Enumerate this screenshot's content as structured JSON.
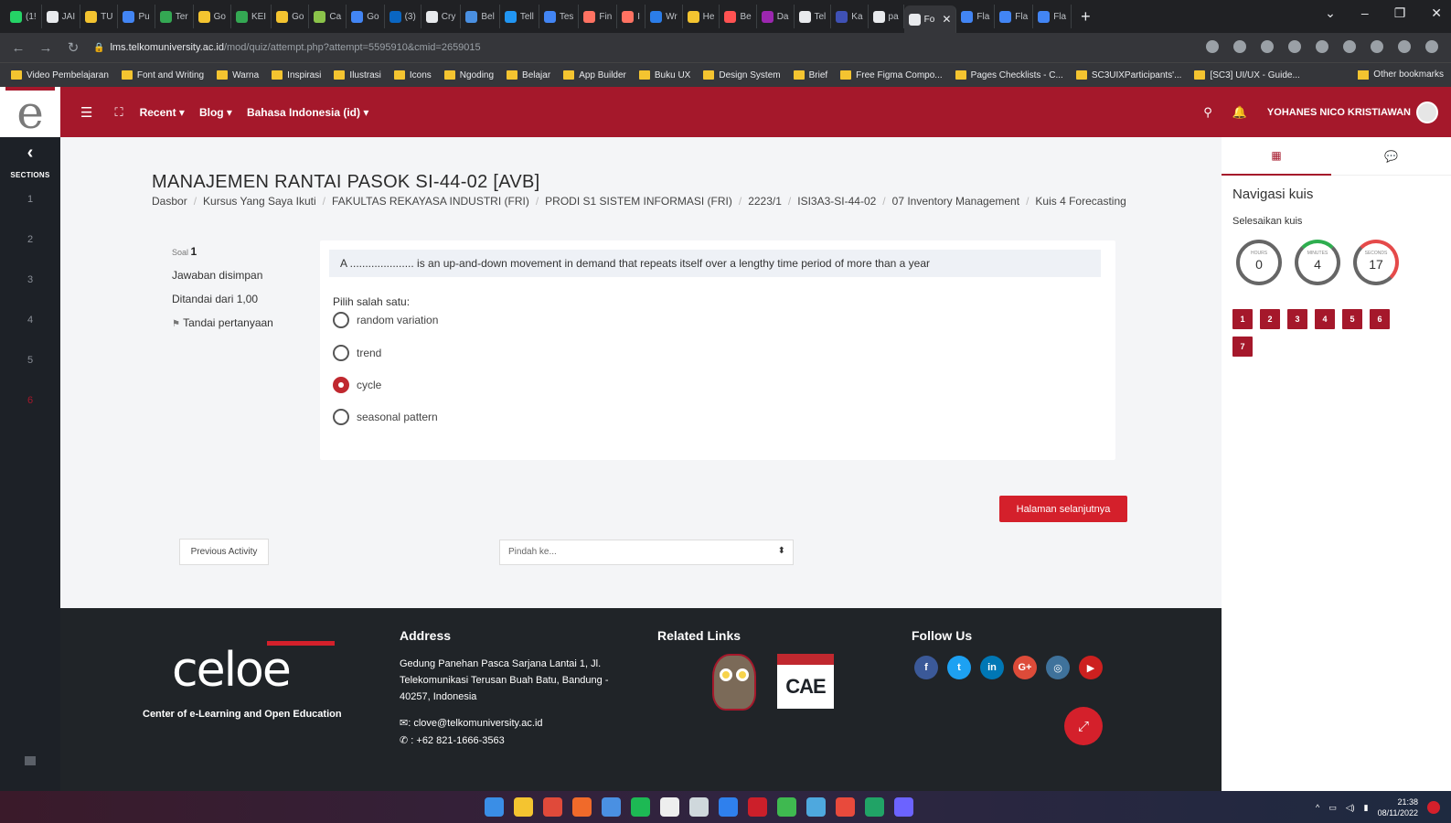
{
  "browser": {
    "tabs": [
      "(1!",
      "JAI",
      "TU",
      "Pu",
      "Ter",
      "Go",
      "KEI",
      "Go",
      "Ca",
      "Go",
      "(3)",
      "Cry",
      "Bel",
      "Tell",
      "Tes",
      "Fin",
      "I",
      "Wr",
      "He",
      "Be",
      "Da",
      "Tel",
      "Ka",
      "pa",
      "Fo",
      "Fla",
      "Fla",
      "Fla"
    ],
    "active_tab_index": 24,
    "url_host": "lms.telkomuniversity.ac.id",
    "url_path": "/mod/quiz/attempt.php?attempt=5595910&cmid=2659015",
    "bookmarks": [
      "Video Pembelajaran",
      "Font and Writing",
      "Warna",
      "Inspirasi",
      "Ilustrasi",
      "Icons",
      "Ngoding",
      "Belajar",
      "App Builder",
      "Buku UX",
      "Design System",
      "Brief",
      "Free Figma Compo...",
      "Pages Checklists - C...",
      "SC3UIXParticipants'...",
      "[SC3] UI/UX - Guide..."
    ],
    "other_bookmarks": "Other bookmarks"
  },
  "header": {
    "menu": [
      "Recent ▾",
      "Blog ▾",
      "Bahasa Indonesia (id) ▾"
    ],
    "username": "YOHANES NICO KRISTIAWAN"
  },
  "sidebar": {
    "title": "SECTIONS",
    "sections": [
      "1",
      "2",
      "3",
      "4",
      "5",
      "6"
    ]
  },
  "course": {
    "title": "MANAJEMEN RANTAI PASOK SI-44-02 [AVB]",
    "breadcrumb": [
      "Dasbor",
      "Kursus Yang Saya Ikuti",
      "FAKULTAS REKAYASA INDUSTRI (FRI)",
      "PRODI S1 SISTEM INFORMASI (FRI)",
      "2223/1",
      "ISI3A3-SI-44-02",
      "07 Inventory Management",
      "Kuis 4 Forecasting"
    ]
  },
  "question": {
    "soal_label": "Soal",
    "number": "1",
    "status": "Jawaban disimpan",
    "marks": "Ditandai dari 1,00",
    "flag": "Tandai pertanyaan",
    "text": "A ..................... is an up-and-down movement in demand that repeats itself over a lengthy time period of more than a year",
    "prompt": "Pilih salah satu:",
    "options": [
      "random variation",
      "trend",
      "cycle",
      "seasonal pattern"
    ],
    "selected_index": 2
  },
  "actions": {
    "next": "Halaman selanjutnya",
    "previous": "Previous Activity",
    "jump_placeholder": "Pindah ke..."
  },
  "quiz_nav": {
    "title": "Navigasi kuis",
    "finish": "Selesaikan kuis",
    "timer": [
      {
        "label": "HOURS",
        "value": "0"
      },
      {
        "label": "MINUTES",
        "value": "4"
      },
      {
        "label": "SECONDS",
        "value": "17"
      }
    ],
    "questions": [
      "1",
      "2",
      "3",
      "4",
      "5",
      "6",
      "7"
    ]
  },
  "footer": {
    "logo": "celoe",
    "tagline": "Center of e-Learning and Open Education",
    "address_title": "Address",
    "address": "Gedung Panehan Pasca Sarjana Lantai 1, Jl. Telekomunikasi Terusan Buah Batu, Bandung - 40257, Indonesia",
    "email": ": clove@telkomuniversity.ac.id",
    "phone": ": +62 821-1666-3563",
    "related_title": "Related Links",
    "cae_logo": "CAE",
    "follow_title": "Follow Us",
    "socials": [
      {
        "icon": "facebook-icon",
        "glyph": "f",
        "color": "#3b5998"
      },
      {
        "icon": "twitter-icon",
        "glyph": "t",
        "color": "#1da1f2"
      },
      {
        "icon": "linkedin-icon",
        "glyph": "in",
        "color": "#0077b5"
      },
      {
        "icon": "google-plus-icon",
        "glyph": "G+",
        "color": "#dd4b39"
      },
      {
        "icon": "instagram-icon",
        "glyph": "◎",
        "color": "#3f729b"
      },
      {
        "icon": "youtube-icon",
        "glyph": "▶",
        "color": "#cd201f"
      }
    ]
  },
  "taskbar": {
    "time": "21:38",
    "date": "08/11/2022"
  },
  "colors": {
    "brand": "#a5182b",
    "accent": "#d4202b",
    "footer_bg": "#202428"
  }
}
